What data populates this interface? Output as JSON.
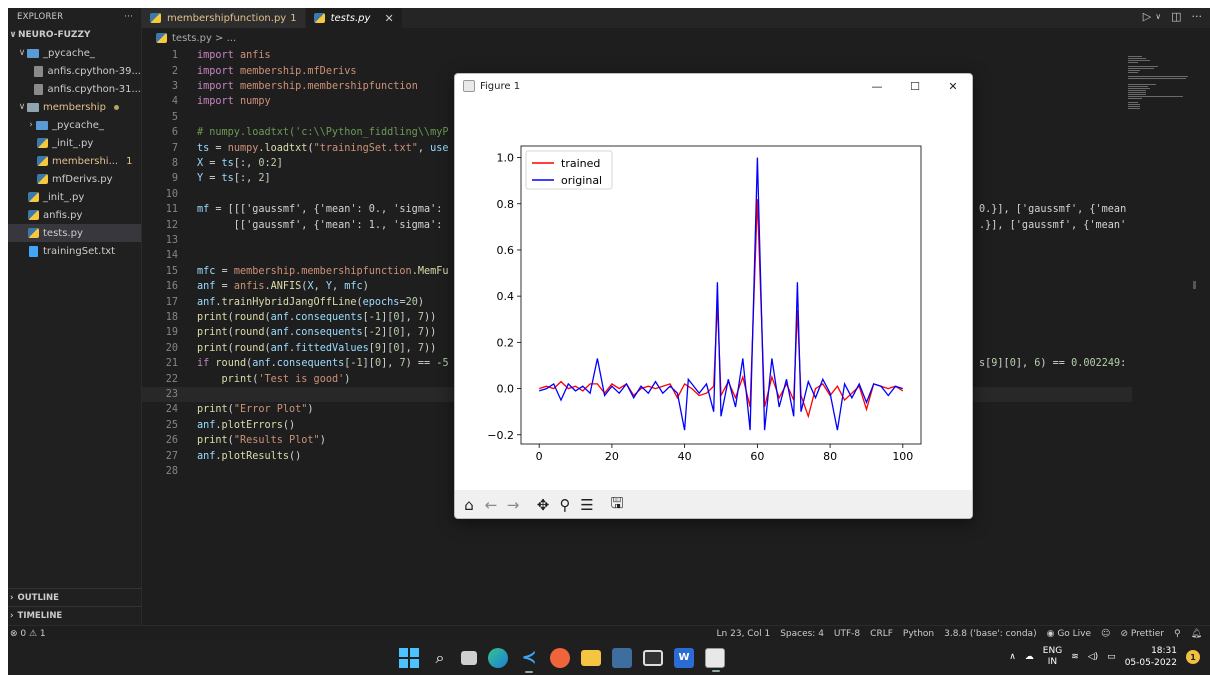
{
  "explorer": {
    "title": "EXPLORER",
    "more": "···",
    "root": "NEURO-FUZZY",
    "items": [
      {
        "label": "_pycache_",
        "indent": 1,
        "kind": "folder-blue",
        "chev": "∨"
      },
      {
        "label": "anfis.cpython-39...",
        "indent": 2,
        "kind": "gen"
      },
      {
        "label": "anfis.cpython-31...",
        "indent": 2,
        "kind": "gen"
      },
      {
        "label": "membership",
        "indent": 1,
        "kind": "folder",
        "chev": "∨",
        "modified": true,
        "dot": true
      },
      {
        "label": "_pycache_",
        "indent": 2,
        "kind": "folder-blue",
        "chev": "›"
      },
      {
        "label": "_init_.py",
        "indent": 2,
        "kind": "py"
      },
      {
        "label": "membershi...",
        "indent": 2,
        "kind": "py",
        "modified": true,
        "badge": "1"
      },
      {
        "label": "mfDerivs.py",
        "indent": 2,
        "kind": "py"
      },
      {
        "label": "_init_.py",
        "indent": 1,
        "kind": "py"
      },
      {
        "label": "anfis.py",
        "indent": 1,
        "kind": "py"
      },
      {
        "label": "tests.py",
        "indent": 1,
        "kind": "py",
        "selected": true
      },
      {
        "label": "trainingSet.txt",
        "indent": 1,
        "kind": "txt"
      }
    ],
    "outline": "OUTLINE",
    "timeline": "TIMELINE"
  },
  "tabs": [
    {
      "label": "membershipfunction.py",
      "count": "1",
      "active": false
    },
    {
      "label": "tests.py",
      "close": "✕",
      "active": true
    }
  ],
  "breadcrumb": "tests.py > ...",
  "editor": {
    "lines": [
      {
        "n": "1",
        "html": "<span class='imp'>import</span> <span class='kw'>anfis</span>"
      },
      {
        "n": "2",
        "html": "<span class='imp'>import</span> <span class='kw'>membership.mfDerivs</span>"
      },
      {
        "n": "3",
        "html": "<span class='imp'>import</span> <span class='kw'>membership.membershipfunction</span>"
      },
      {
        "n": "4",
        "html": "<span class='imp'>import</span> <span class='kw'>numpy</span>"
      },
      {
        "n": "5",
        "html": ""
      },
      {
        "n": "6",
        "html": "<span class='cm'># numpy.loadtxt('c:\\\\Python_fiddling\\\\myP</span>"
      },
      {
        "n": "7",
        "html": "<span class='var'>ts</span> = <span class='kw'>numpy</span>.<span class='fn'>loadtxt</span>(<span class='str'>\"trainingSet.txt\"</span>, <span class='var'>use</span>"
      },
      {
        "n": "8",
        "html": "<span class='var'>X</span> = <span class='var'>ts</span>[:, <span class='num'>0</span>:<span class='num'>2</span>]"
      },
      {
        "n": "9",
        "html": "<span class='var'>Y</span> = <span class='var'>ts</span>[:, <span class='num'>2</span>]"
      },
      {
        "n": "10",
        "html": ""
      },
      {
        "n": "11",
        "html": "<span class='var'>mf</span> = [[['gaussmf', {'mean': 0., 'sigma':</span>"
      },
      {
        "n": "12",
        "html": "      [['gaussmf', {'mean': 1., 'sigma':"
      },
      {
        "n": "13",
        "html": ""
      },
      {
        "n": "14",
        "html": ""
      },
      {
        "n": "15",
        "html": "<span class='var'>mfc</span> = <span class='kw'>membership.membershipfunction</span>.<span class='fn'>MemFu</span>"
      },
      {
        "n": "16",
        "html": "<span class='var'>anf</span> = <span class='kw'>anfis</span>.<span class='fn'>ANFIS</span>(<span class='var'>X</span>, <span class='var'>Y</span>, <span class='var'>mfc</span>)"
      },
      {
        "n": "17",
        "html": "<span class='var'>anf</span>.<span class='fn'>trainHybridJangOffLine</span>(<span class='var'>epochs</span>=<span class='num'>20</span>)"
      },
      {
        "n": "18",
        "html": "<span class='fn'>print</span>(<span class='fn'>round</span>(<span class='var'>anf</span>.<span class='var'>consequents</span>[-<span class='num'>1</span>][<span class='num'>0</span>], <span class='num'>7</span>))"
      },
      {
        "n": "19",
        "html": "<span class='fn'>print</span>(<span class='fn'>round</span>(<span class='var'>anf</span>.<span class='var'>consequents</span>[-<span class='num'>2</span>][<span class='num'>0</span>], <span class='num'>7</span>))"
      },
      {
        "n": "20",
        "html": "<span class='fn'>print</span>(<span class='fn'>round</span>(<span class='var'>anf</span>.<span class='var'>fittedValues</span>[<span class='num'>9</span>][<span class='num'>0</span>], <span class='num'>7</span>))"
      },
      {
        "n": "21",
        "html": "<span class='imp'>if</span> <span class='fn'>round</span>(<span class='var'>anf</span>.<span class='var'>consequents</span>[-<span class='num'>1</span>][<span class='num'>0</span>], <span class='num'>7</span>) == -<span class='num'>5</span>"
      },
      {
        "n": "22",
        "html": "    <span class='fn'>print</span>(<span class='str'>'Test is good'</span>)"
      },
      {
        "n": "23",
        "html": "",
        "current": true
      },
      {
        "n": "24",
        "html": "<span class='fn'>print</span>(<span class='str'>\"Error Plot\"</span>)"
      },
      {
        "n": "25",
        "html": "<span class='var'>anf</span>.<span class='fn'>plotErrors</span>()"
      },
      {
        "n": "26",
        "html": "<span class='fn'>print</span>(<span class='str'>\"Results Plot\"</span>)"
      },
      {
        "n": "27",
        "html": "<span class='var'>anf</span>.<span class='fn'>plotResults</span>()"
      },
      {
        "n": "28",
        "html": ""
      }
    ],
    "right_fragments": [
      {
        "line": "11",
        "html": "0.}], ['gaussmf', {'mean"
      },
      {
        "line": "12",
        "html": ".}], ['gaussmf', {'mean'"
      },
      {
        "line": "21",
        "html": "s[<span class='num'>9</span>][<span class='num'>0</span>], <span class='num'>6</span>) == <span class='num'>0.002249</span>:"
      }
    ]
  },
  "statusbar": {
    "left": "⊗ 0 ⚠ 1",
    "ln_col": "Ln 23, Col 1",
    "spaces": "Spaces: 4",
    "encoding": "UTF-8",
    "eol": "CRLF",
    "language": "Python",
    "interpreter": "3.8.8 ('base': conda)",
    "golive": "Go Live",
    "prettier": "Prettier"
  },
  "figure": {
    "title": "Figure 1",
    "minimize": "—",
    "maximize": "☐",
    "close": "✕"
  },
  "chart_data": {
    "type": "line",
    "title": "",
    "xlabel": "",
    "ylabel": "",
    "xlim": [
      -5,
      105
    ],
    "ylim": [
      -0.24,
      1.05
    ],
    "xticks": [
      "0",
      "20",
      "40",
      "60",
      "80",
      "100"
    ],
    "yticks": [
      "−0.2",
      "0.0",
      "0.2",
      "0.4",
      "0.6",
      "0.8",
      "1.0"
    ],
    "legend": "top-left",
    "series": [
      {
        "name": "trained",
        "color": "#ff0000",
        "x": [
          0,
          2,
          4,
          6,
          8,
          10,
          12,
          14,
          16,
          18,
          20,
          22,
          24,
          26,
          28,
          30,
          32,
          34,
          36,
          38,
          40,
          42,
          44,
          46,
          48,
          49,
          50,
          52,
          54,
          56,
          58,
          60,
          62,
          64,
          66,
          68,
          70,
          71,
          72,
          74,
          76,
          78,
          80,
          82,
          84,
          86,
          88,
          90,
          92,
          94,
          96,
          98,
          100
        ],
        "y": [
          0.0,
          0.01,
          0.0,
          0.03,
          0.0,
          0.01,
          -0.01,
          0.02,
          0.02,
          -0.02,
          0.02,
          0.0,
          0.02,
          -0.03,
          0.0,
          0.01,
          0.0,
          0.01,
          0.02,
          -0.04,
          0.02,
          0.0,
          -0.03,
          -0.02,
          0.01,
          0.37,
          -0.03,
          0.03,
          -0.04,
          0.05,
          -0.08,
          0.82,
          -0.08,
          0.05,
          -0.04,
          0.02,
          -0.05,
          0.34,
          -0.03,
          -0.12,
          0.0,
          0.02,
          -0.03,
          0.01,
          -0.05,
          -0.02,
          0.01,
          -0.09,
          0.02,
          0.01,
          0.0,
          0.01,
          -0.01
        ]
      },
      {
        "name": "original",
        "color": "#0000ff",
        "x": [
          0,
          2,
          4,
          6,
          8,
          10,
          12,
          14,
          16,
          18,
          20,
          22,
          24,
          26,
          28,
          30,
          32,
          34,
          36,
          38,
          40,
          41,
          42,
          44,
          46,
          48,
          49,
          50,
          52,
          54,
          56,
          58,
          60,
          62,
          64,
          66,
          68,
          70,
          71,
          72,
          74,
          76,
          78,
          80,
          82,
          84,
          86,
          88,
          90,
          92,
          94,
          96,
          98,
          100
        ],
        "y": [
          -0.01,
          0.0,
          0.02,
          -0.05,
          0.02,
          -0.01,
          0.01,
          -0.02,
          0.13,
          -0.03,
          0.01,
          -0.02,
          0.02,
          -0.04,
          0.01,
          -0.02,
          0.03,
          -0.02,
          0.01,
          -0.02,
          -0.18,
          0.04,
          0.02,
          -0.02,
          0.02,
          -0.1,
          0.46,
          -0.12,
          0.04,
          -0.08,
          0.13,
          -0.18,
          1.0,
          -0.18,
          0.13,
          -0.08,
          0.04,
          -0.12,
          0.46,
          -0.1,
          0.03,
          -0.04,
          0.04,
          -0.02,
          -0.18,
          0.02,
          -0.04,
          0.02,
          -0.06,
          0.02,
          0.01,
          -0.03,
          0.01,
          0.0
        ]
      }
    ]
  },
  "taskbar": {
    "lang1": "ENG",
    "lang2": "IN",
    "time": "18:31",
    "date": "05-05-2022",
    "notifications": "1"
  }
}
